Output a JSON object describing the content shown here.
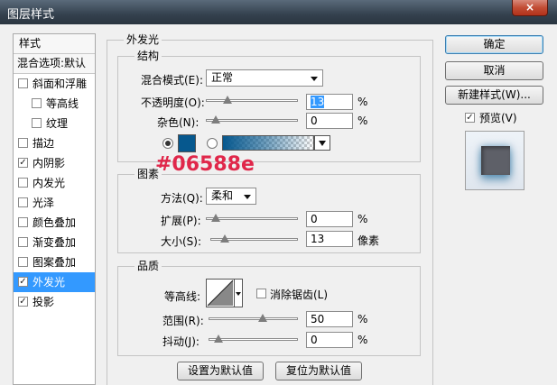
{
  "window": {
    "title": "图层样式",
    "close_glyph": "×"
  },
  "sidebar": {
    "header": "样式",
    "subheader": "混合选项:默认",
    "items": [
      {
        "label": "斜面和浮雕",
        "checked": false,
        "indent": false,
        "selected": false
      },
      {
        "label": "等高线",
        "checked": false,
        "indent": true,
        "selected": false
      },
      {
        "label": "纹理",
        "checked": false,
        "indent": true,
        "selected": false
      },
      {
        "label": "描边",
        "checked": false,
        "indent": false,
        "selected": false
      },
      {
        "label": "内阴影",
        "checked": true,
        "indent": false,
        "selected": false
      },
      {
        "label": "内发光",
        "checked": false,
        "indent": false,
        "selected": false
      },
      {
        "label": "光泽",
        "checked": false,
        "indent": false,
        "selected": false
      },
      {
        "label": "颜色叠加",
        "checked": false,
        "indent": false,
        "selected": false
      },
      {
        "label": "渐变叠加",
        "checked": false,
        "indent": false,
        "selected": false
      },
      {
        "label": "图案叠加",
        "checked": false,
        "indent": false,
        "selected": false
      },
      {
        "label": "外发光",
        "checked": true,
        "indent": false,
        "selected": true
      },
      {
        "label": "投影",
        "checked": true,
        "indent": false,
        "selected": false
      }
    ]
  },
  "panel": {
    "title": "外发光",
    "structure": {
      "title": "结构",
      "blend_mode_label": "混合模式(E):",
      "blend_mode_value": "正常",
      "opacity_label": "不透明度(O):",
      "opacity_value": "13",
      "opacity_level": 0.13,
      "noise_label": "杂色(N):",
      "noise_value": "0",
      "noise_level": 0,
      "percent": "%",
      "color": "#06588e",
      "color_radio_selected": true,
      "gradient_radio_selected": false
    },
    "elements": {
      "title": "图素",
      "method_label": "方法(Q):",
      "method_value": "柔和",
      "spread_label": "扩展(P):",
      "spread_value": "0",
      "spread_level": 0,
      "size_label": "大小(S):",
      "size_value": "13",
      "size_level": 0.05,
      "size_unit": "像素",
      "percent": "%"
    },
    "quality": {
      "title": "品质",
      "contour_label": "等高线:",
      "antialias_label": "消除锯齿(L)",
      "antialias_checked": false,
      "range_label": "范围(R):",
      "range_value": "50",
      "range_level": 0.5,
      "jitter_label": "抖动(J):",
      "jitter_value": "0",
      "jitter_level": 0,
      "percent": "%"
    },
    "set_default_label": "设置为默认值",
    "reset_default_label": "复位为默认值"
  },
  "right": {
    "ok_label": "确定",
    "cancel_label": "取消",
    "new_style_label": "新建样式(W)...",
    "preview_label": "预览(V)",
    "preview_checked": true
  },
  "annotation": {
    "text": "#06588e",
    "color": "#e0274a"
  }
}
